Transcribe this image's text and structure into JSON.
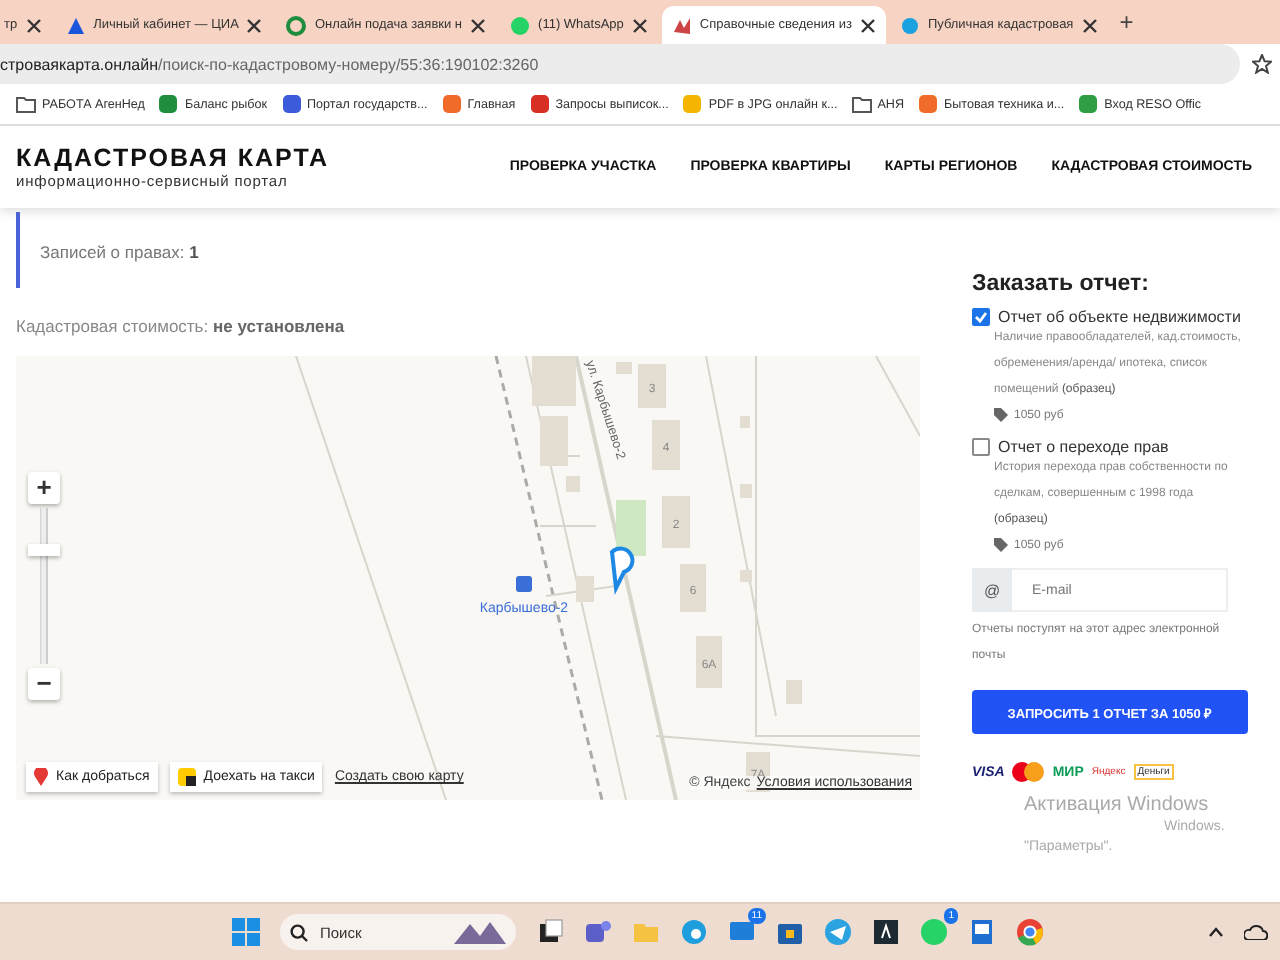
{
  "browser": {
    "tabs": [
      {
        "title": "тр",
        "selected": false
      },
      {
        "title": "Личный кабинет — ЦИА",
        "selected": false
      },
      {
        "title": "Онлайн подача заявки н",
        "selected": false
      },
      {
        "title": "(11) WhatsApp",
        "selected": false
      },
      {
        "title": "Справочные сведения из",
        "selected": true
      },
      {
        "title": "Публичная кадастровая",
        "selected": false
      }
    ],
    "new_tab": "+",
    "address": {
      "domain": "строваякарта.онлайн",
      "path": "/поиск-по-кадастровому-номеру/55:36:190102:3260"
    },
    "bookmarks": [
      {
        "label": "РАБОТА АгенНед",
        "kind": "folder",
        "color": "#555555"
      },
      {
        "label": "Баланс рыбок",
        "kind": "site",
        "color": "#1e8e3e"
      },
      {
        "label": "Портал государств...",
        "kind": "site",
        "color": "#3b5bdb"
      },
      {
        "label": "Главная",
        "kind": "site",
        "color": "#f06a2a"
      },
      {
        "label": "Запросы выписок...",
        "kind": "site",
        "color": "#d93025"
      },
      {
        "label": "PDF в JPG онлайн к...",
        "kind": "site",
        "color": "#f4b400"
      },
      {
        "label": "АНЯ",
        "kind": "folder",
        "color": "#555555"
      },
      {
        "label": "Бытовая техника и...",
        "kind": "site",
        "color": "#f06a2a"
      },
      {
        "label": "Вход RESO Offic",
        "kind": "site",
        "color": "#2e9e44"
      }
    ]
  },
  "header": {
    "logo": "КАДАСТРОВАЯ КАРТА",
    "tagline": "информационно-сервисный портал",
    "nav": [
      "ПРОВЕРКА УЧАСТКА",
      "ПРОВЕРКА КВАРТИРЫ",
      "КАРТЫ РЕГИОНОВ",
      "КАДАСТРОВАЯ СТОИМОСТЬ"
    ]
  },
  "rights": {
    "label": "Записей о правах:",
    "value": "1"
  },
  "cost": {
    "label": "Кадастровая стоимость:",
    "value": "не установлена"
  },
  "map": {
    "street": "ул. Карбышево-2",
    "station": "Карбышево-2",
    "buildings": [
      {
        "number": "3"
      },
      {
        "number": "4"
      },
      {
        "number": "2"
      },
      {
        "number": "6"
      },
      {
        "number": "6А"
      },
      {
        "number": "7А"
      }
    ],
    "zoom": {
      "level": 0.75
    },
    "zoom_in": "+",
    "zoom_out": "−",
    "route": "Как добраться",
    "taxi": "Доехать на такси",
    "create": "Создать свою карту",
    "copyright": "© Яндекс",
    "terms": "Условия использования"
  },
  "order": {
    "title": "Заказать отчет:",
    "options": [
      {
        "label": "Отчет об объекте недвижимости",
        "checked": true,
        "desc": "Наличие правообладателей, кад.стоимость, обременения/аренда/ ипотека, список помещений",
        "sample": "(образец)",
        "price": "1050 руб"
      },
      {
        "label": "Отчет о переходе прав",
        "checked": false,
        "desc": "История перехода прав собственности по сделкам, совершенным с 1998 года",
        "sample": "(образец)",
        "price": "1050 руб"
      }
    ],
    "email": {
      "prefix": "@",
      "placeholder": "E-mail"
    },
    "note": "Отчеты поступят на этот адрес электронной почты",
    "button": "ЗАПРОСИТЬ 1 ОТЧЕТ ЗА 1050 ₽",
    "payments": [
      "VISA",
      "МИР",
      "Яндекс",
      "Деньги"
    ]
  },
  "activation": {
    "title": "Активация Windows",
    "line": "Windows.",
    "line2": "\"Параметры\"."
  },
  "taskbar": {
    "search": "Поиск",
    "badges": [
      "11",
      "1"
    ]
  }
}
